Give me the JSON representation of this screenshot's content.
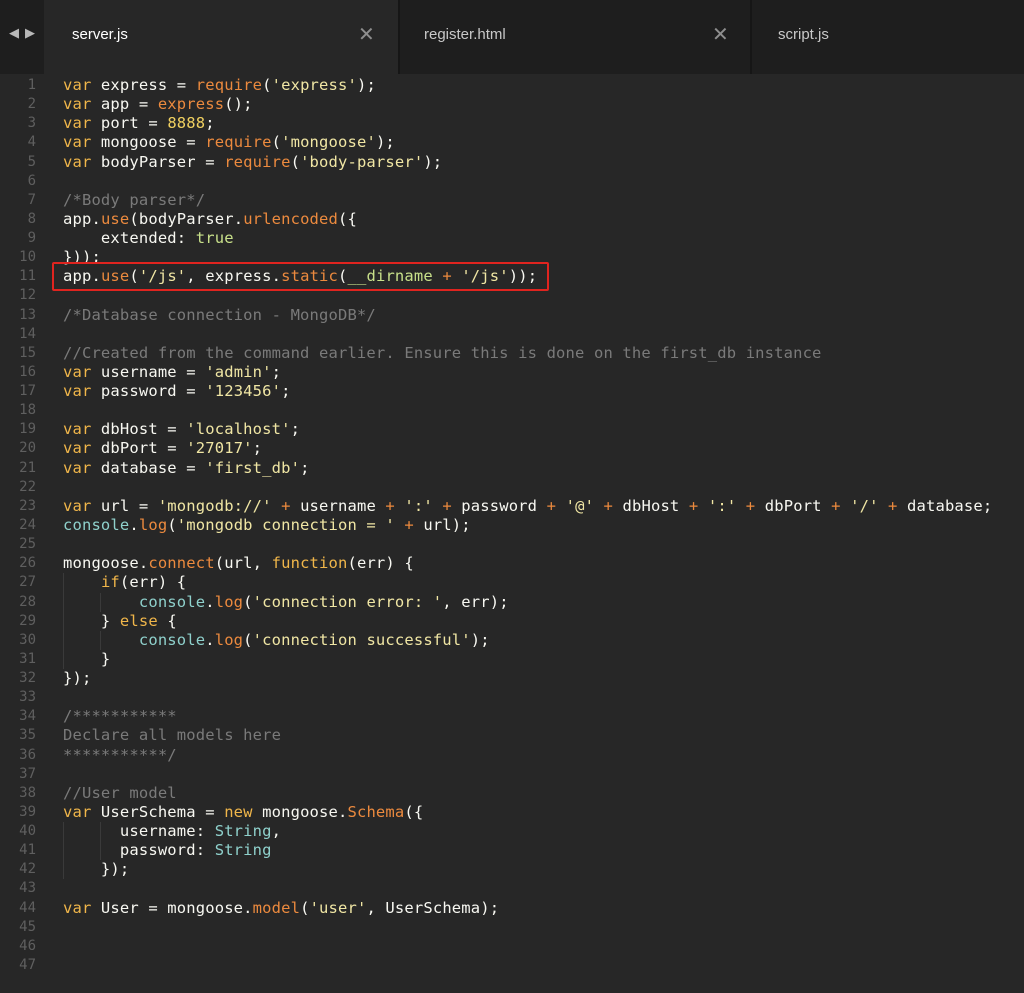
{
  "tabs": [
    {
      "label": "server.js",
      "active": true,
      "closable": true
    },
    {
      "label": "register.html",
      "active": false,
      "closable": true
    },
    {
      "label": "script.js",
      "active": false,
      "closable": false
    }
  ],
  "nav": {
    "back": "◀",
    "forward": "▶",
    "close": "✕"
  },
  "highlighted_line": 11,
  "highlight_color": "#e0241f",
  "code_lines": [
    [
      [
        "kw",
        "var"
      ],
      [
        "p",
        " express = "
      ],
      [
        "fn",
        "require"
      ],
      [
        "p",
        "("
      ],
      [
        "str",
        "'express'"
      ],
      [
        "p",
        ");"
      ]
    ],
    [
      [
        "kw",
        "var"
      ],
      [
        "p",
        " app = "
      ],
      [
        "fn",
        "express"
      ],
      [
        "p",
        "();"
      ]
    ],
    [
      [
        "kw",
        "var"
      ],
      [
        "p",
        " port = "
      ],
      [
        "num",
        "8888"
      ],
      [
        "p",
        ";"
      ]
    ],
    [
      [
        "kw",
        "var"
      ],
      [
        "p",
        " mongoose = "
      ],
      [
        "fn",
        "require"
      ],
      [
        "p",
        "("
      ],
      [
        "str",
        "'mongoose'"
      ],
      [
        "p",
        ");"
      ]
    ],
    [
      [
        "kw",
        "var"
      ],
      [
        "p",
        " bodyParser = "
      ],
      [
        "fn",
        "require"
      ],
      [
        "p",
        "("
      ],
      [
        "str",
        "'body-parser'"
      ],
      [
        "p",
        ");"
      ]
    ],
    [],
    [
      [
        "cm",
        "/*Body parser*/"
      ]
    ],
    [
      [
        "p",
        "app."
      ],
      [
        "fn",
        "use"
      ],
      [
        "p",
        "(bodyParser."
      ],
      [
        "fn",
        "urlencoded"
      ],
      [
        "p",
        "({"
      ]
    ],
    [
      [
        "p",
        "    extended: "
      ],
      [
        "bool",
        "true"
      ]
    ],
    [
      [
        "p",
        "}));"
      ]
    ],
    [
      [
        "p",
        "app."
      ],
      [
        "fn",
        "use"
      ],
      [
        "p",
        "("
      ],
      [
        "str",
        "'/js'"
      ],
      [
        "p",
        ", express."
      ],
      [
        "fn",
        "static"
      ],
      [
        "p",
        "("
      ],
      [
        "bool",
        "__dirname"
      ],
      [
        "p",
        " "
      ],
      [
        "op",
        "+"
      ],
      [
        "p",
        " "
      ],
      [
        "str",
        "'/js'"
      ],
      [
        "p",
        "));"
      ]
    ],
    [],
    [
      [
        "cm",
        "/*Database connection - MongoDB*/"
      ]
    ],
    [],
    [
      [
        "cm",
        "//Created from the command earlier. Ensure this is done on the first_db instance"
      ]
    ],
    [
      [
        "kw",
        "var"
      ],
      [
        "p",
        " username = "
      ],
      [
        "str",
        "'admin'"
      ],
      [
        "p",
        ";"
      ]
    ],
    [
      [
        "kw",
        "var"
      ],
      [
        "p",
        " password = "
      ],
      [
        "str",
        "'123456'"
      ],
      [
        "p",
        ";"
      ]
    ],
    [],
    [
      [
        "kw",
        "var"
      ],
      [
        "p",
        " dbHost = "
      ],
      [
        "str",
        "'localhost'"
      ],
      [
        "p",
        ";"
      ]
    ],
    [
      [
        "kw",
        "var"
      ],
      [
        "p",
        " dbPort = "
      ],
      [
        "str",
        "'27017'"
      ],
      [
        "p",
        ";"
      ]
    ],
    [
      [
        "kw",
        "var"
      ],
      [
        "p",
        " database = "
      ],
      [
        "str",
        "'first_db'"
      ],
      [
        "p",
        ";"
      ]
    ],
    [],
    [
      [
        "kw",
        "var"
      ],
      [
        "p",
        " url = "
      ],
      [
        "str",
        "'mongodb://'"
      ],
      [
        "p",
        " "
      ],
      [
        "op",
        "+"
      ],
      [
        "p",
        " username "
      ],
      [
        "op",
        "+"
      ],
      [
        "p",
        " "
      ],
      [
        "str",
        "':'"
      ],
      [
        "p",
        " "
      ],
      [
        "op",
        "+"
      ],
      [
        "p",
        " password "
      ],
      [
        "op",
        "+"
      ],
      [
        "p",
        " "
      ],
      [
        "str",
        "'@'"
      ],
      [
        "p",
        " "
      ],
      [
        "op",
        "+"
      ],
      [
        "p",
        " dbHost "
      ],
      [
        "op",
        "+"
      ],
      [
        "p",
        " "
      ],
      [
        "str",
        "':'"
      ],
      [
        "p",
        " "
      ],
      [
        "op",
        "+"
      ],
      [
        "p",
        " dbPort "
      ],
      [
        "op",
        "+"
      ],
      [
        "p",
        " "
      ],
      [
        "str",
        "'/'"
      ],
      [
        "p",
        " "
      ],
      [
        "op",
        "+"
      ],
      [
        "p",
        " database;"
      ]
    ],
    [
      [
        "typ",
        "console"
      ],
      [
        "p",
        "."
      ],
      [
        "fn",
        "log"
      ],
      [
        "p",
        "("
      ],
      [
        "str",
        "'mongodb connection = '"
      ],
      [
        "p",
        " "
      ],
      [
        "op",
        "+"
      ],
      [
        "p",
        " url);"
      ]
    ],
    [],
    [
      [
        "p",
        "mongoose."
      ],
      [
        "fn",
        "connect"
      ],
      [
        "p",
        "(url, "
      ],
      [
        "kw",
        "function"
      ],
      [
        "p",
        "(err) {"
      ]
    ],
    [
      [
        "p",
        "    "
      ],
      [
        "kw",
        "if"
      ],
      [
        "p",
        "(err) {"
      ]
    ],
    [
      [
        "p",
        "        "
      ],
      [
        "typ",
        "console"
      ],
      [
        "p",
        "."
      ],
      [
        "fn",
        "log"
      ],
      [
        "p",
        "("
      ],
      [
        "str",
        "'connection error: '"
      ],
      [
        "p",
        ", err);"
      ]
    ],
    [
      [
        "p",
        "    } "
      ],
      [
        "kw",
        "else"
      ],
      [
        "p",
        " {"
      ]
    ],
    [
      [
        "p",
        "        "
      ],
      [
        "typ",
        "console"
      ],
      [
        "p",
        "."
      ],
      [
        "fn",
        "log"
      ],
      [
        "p",
        "("
      ],
      [
        "str",
        "'connection successful'"
      ],
      [
        "p",
        ");"
      ]
    ],
    [
      [
        "p",
        "    }"
      ]
    ],
    [
      [
        "p",
        "});"
      ]
    ],
    [],
    [
      [
        "cm",
        "/***********"
      ]
    ],
    [
      [
        "cm",
        "Declare all models here"
      ]
    ],
    [
      [
        "cm",
        "***********/"
      ]
    ],
    [],
    [
      [
        "cm",
        "//User model"
      ]
    ],
    [
      [
        "kw",
        "var"
      ],
      [
        "p",
        " UserSchema = "
      ],
      [
        "kw",
        "new"
      ],
      [
        "p",
        " mongoose."
      ],
      [
        "fn",
        "Schema"
      ],
      [
        "p",
        "({"
      ]
    ],
    [
      [
        "p",
        "      username: "
      ],
      [
        "typ",
        "String"
      ],
      [
        "p",
        ","
      ]
    ],
    [
      [
        "p",
        "      password: "
      ],
      [
        "typ",
        "String"
      ]
    ],
    [
      [
        "p",
        "    });"
      ]
    ],
    [],
    [
      [
        "kw",
        "var"
      ],
      [
        "p",
        " User = mongoose."
      ],
      [
        "fn",
        "model"
      ],
      [
        "p",
        "("
      ],
      [
        "str",
        "'user'"
      ],
      [
        "p",
        ", UserSchema);"
      ]
    ],
    [],
    [],
    []
  ]
}
